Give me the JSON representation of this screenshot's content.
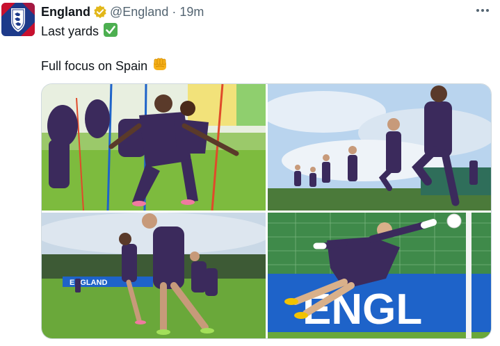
{
  "tweet": {
    "author_name": "England",
    "author_handle": "@England",
    "separator": "·",
    "time": "19m",
    "text_line1": "Last yards",
    "emoji1": "✅",
    "text_line2": "Full focus on Spain",
    "emoji2": "👊"
  },
  "media": {
    "banner_text_photo3": "ENGLAND",
    "banner_text_photo4": "ENGL"
  },
  "colors": {
    "verified_badge": "#E2B719",
    "check_emoji": "#4CAF50",
    "fist_emoji": "#F6B11A",
    "kit_navy": "#3B2A5C",
    "pitch_green": "#7DBB3E",
    "sky_blue": "#B9D4EE",
    "board_blue": "#1E63C9"
  },
  "icons": {
    "avatar": "england-crest-icon",
    "badge": "verified-badge-icon",
    "menu": "more-options-icon"
  }
}
